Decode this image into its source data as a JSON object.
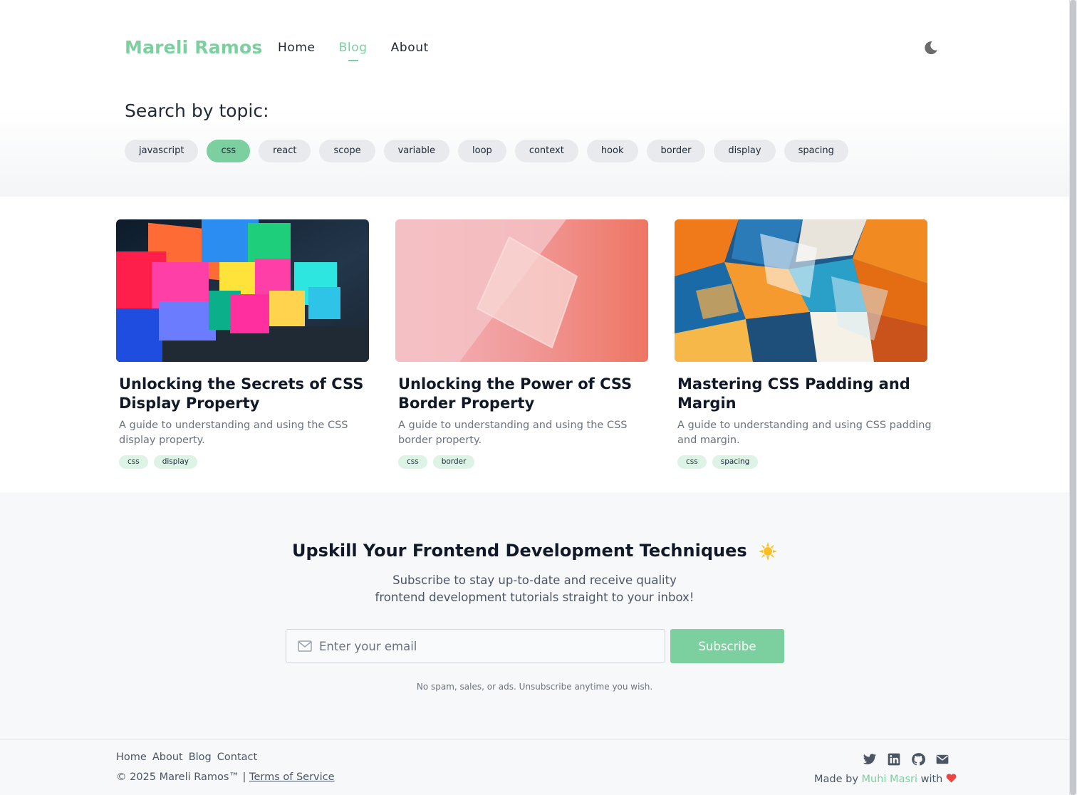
{
  "header": {
    "logo": "Mareli Ramos",
    "nav": [
      "Home",
      "Blog",
      "About"
    ],
    "active_nav": "Blog"
  },
  "search": {
    "title": "Search by topic:",
    "topics": [
      "javascript",
      "css",
      "react",
      "scope",
      "variable",
      "loop",
      "context",
      "hook",
      "border",
      "display",
      "spacing"
    ],
    "active_topic": "css"
  },
  "posts": [
    {
      "title": "Unlocking the Secrets of CSS Display Property",
      "description": "A guide to understanding and using the CSS display property.",
      "tags": [
        "css",
        "display"
      ]
    },
    {
      "title": "Unlocking the Power of CSS Border Property",
      "description": "A guide to understanding and using the CSS border property.",
      "tags": [
        "css",
        "border"
      ]
    },
    {
      "title": "Mastering CSS Padding and Margin",
      "description": "A guide to understanding and using CSS padding and margin.",
      "tags": [
        "css",
        "spacing"
      ]
    }
  ],
  "newsletter": {
    "title": "Upskill Your Frontend Development Techniques",
    "text_line1": "Subscribe to stay up-to-date and receive quality",
    "text_line2": "frontend development tutorials straight to your inbox!",
    "email_placeholder": "Enter your email",
    "subscribe_label": "Subscribe",
    "note": "No spam, sales, or ads. Unsubscribe anytime you wish."
  },
  "footer": {
    "links": [
      "Home",
      "About",
      "Blog",
      "Contact"
    ],
    "copyright": "© 2025 Mareli Ramos™ |",
    "terms": "Terms of Service",
    "made_by": "Made by",
    "author": "Muhi Masri",
    "with": "with",
    "social_icons": [
      "twitter-icon",
      "linkedin-icon",
      "github-icon",
      "mail-icon"
    ]
  },
  "colors": {
    "accent": "#7ccf9e",
    "tag_bg": "#dcf3e6",
    "chip_bg": "#e8eaed"
  }
}
